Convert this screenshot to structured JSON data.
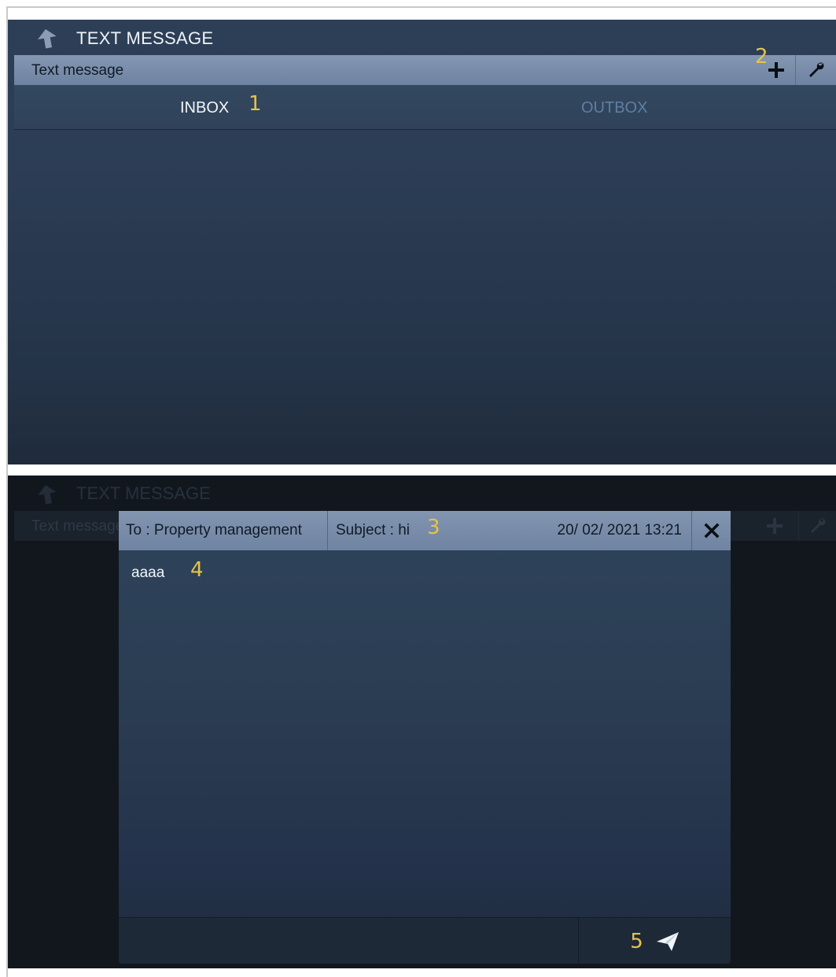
{
  "screen1": {
    "title": "TEXT MESSAGE",
    "subbar_label": "Text message",
    "tabs": [
      {
        "label": "INBOX",
        "active": true
      },
      {
        "label": "OUTBOX",
        "active": false
      }
    ],
    "markers": {
      "inbox": "1",
      "add": "2"
    }
  },
  "screen2": {
    "background_title": "TEXT MESSAGE",
    "background_subbar_label": "Text message",
    "dialog": {
      "to": "To : Property management",
      "subject": "Subject : hi",
      "date": "20/ 02/ 2021  13:21",
      "body": "aaaa"
    },
    "markers": {
      "subject": "3",
      "body": "4",
      "send": "5"
    }
  },
  "icons": {
    "back": "back-arrow-icon",
    "add": "plus-icon",
    "settings": "wrench-icon",
    "close": "close-icon",
    "send": "paper-plane-icon"
  },
  "colors": {
    "accent_marker": "#e6c24b",
    "inactive_tab": "#5f7fa6",
    "bar": "#7b8fab"
  }
}
